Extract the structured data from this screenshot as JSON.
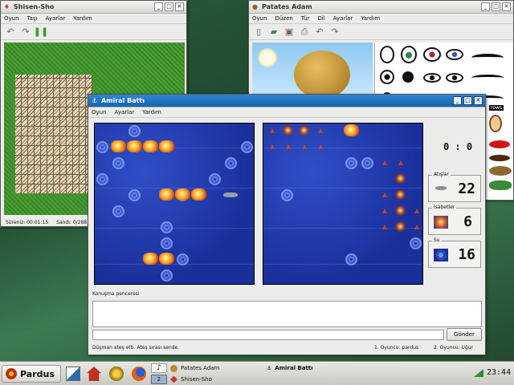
{
  "shisen": {
    "title": "Shisen-Sho",
    "menu": [
      "Oyun",
      "Taşı",
      "Ayarlar",
      "Yardım"
    ],
    "status_time": "Süreniz: 00:01:15",
    "status_tiles": "Sandı: 0/288"
  },
  "potato": {
    "title": "Patates Adam",
    "menu": [
      "Oyun",
      "Düzen",
      "Tür",
      "Dil",
      "Ayarlar",
      "Yardım"
    ],
    "side_label": "rows"
  },
  "battle": {
    "title": "Amiral Battı",
    "menu": [
      "Oyun",
      "Ayarlar",
      "Yardım"
    ],
    "score": "0 : 0",
    "shots_label": "Atışlar",
    "shots_value": "22",
    "hits_label": "İsabetler",
    "hits_value": "6",
    "water_label": "Su",
    "water_value": "16",
    "chat_label": "Konuşma penceresi",
    "chat_input_placeholder": "",
    "send_label": "Gönder",
    "status_message": "Düşman ateş etti. Ateş sırası sende.",
    "player1": "1. Oyuncu: pardus",
    "player2": "2. Oyuncu: Uğur"
  },
  "taskbar": {
    "start_label": "Pardus",
    "workspace": "2",
    "tasks": [
      "Patates Adam",
      "Shisen-Sho",
      "Amiral Battı"
    ],
    "clock": "23:44"
  },
  "colors": {
    "accent": "#1565b0",
    "sea": "#1a2f9a",
    "felt": "#3c8a2a",
    "desktop": "#2a5a3a"
  },
  "icons": [
    "undo-icon",
    "redo-icon",
    "pause-icon",
    "new-icon",
    "open-icon",
    "save-icon",
    "print-icon",
    "minimize-icon",
    "maximize-icon",
    "close-icon",
    "clock-icon"
  ]
}
